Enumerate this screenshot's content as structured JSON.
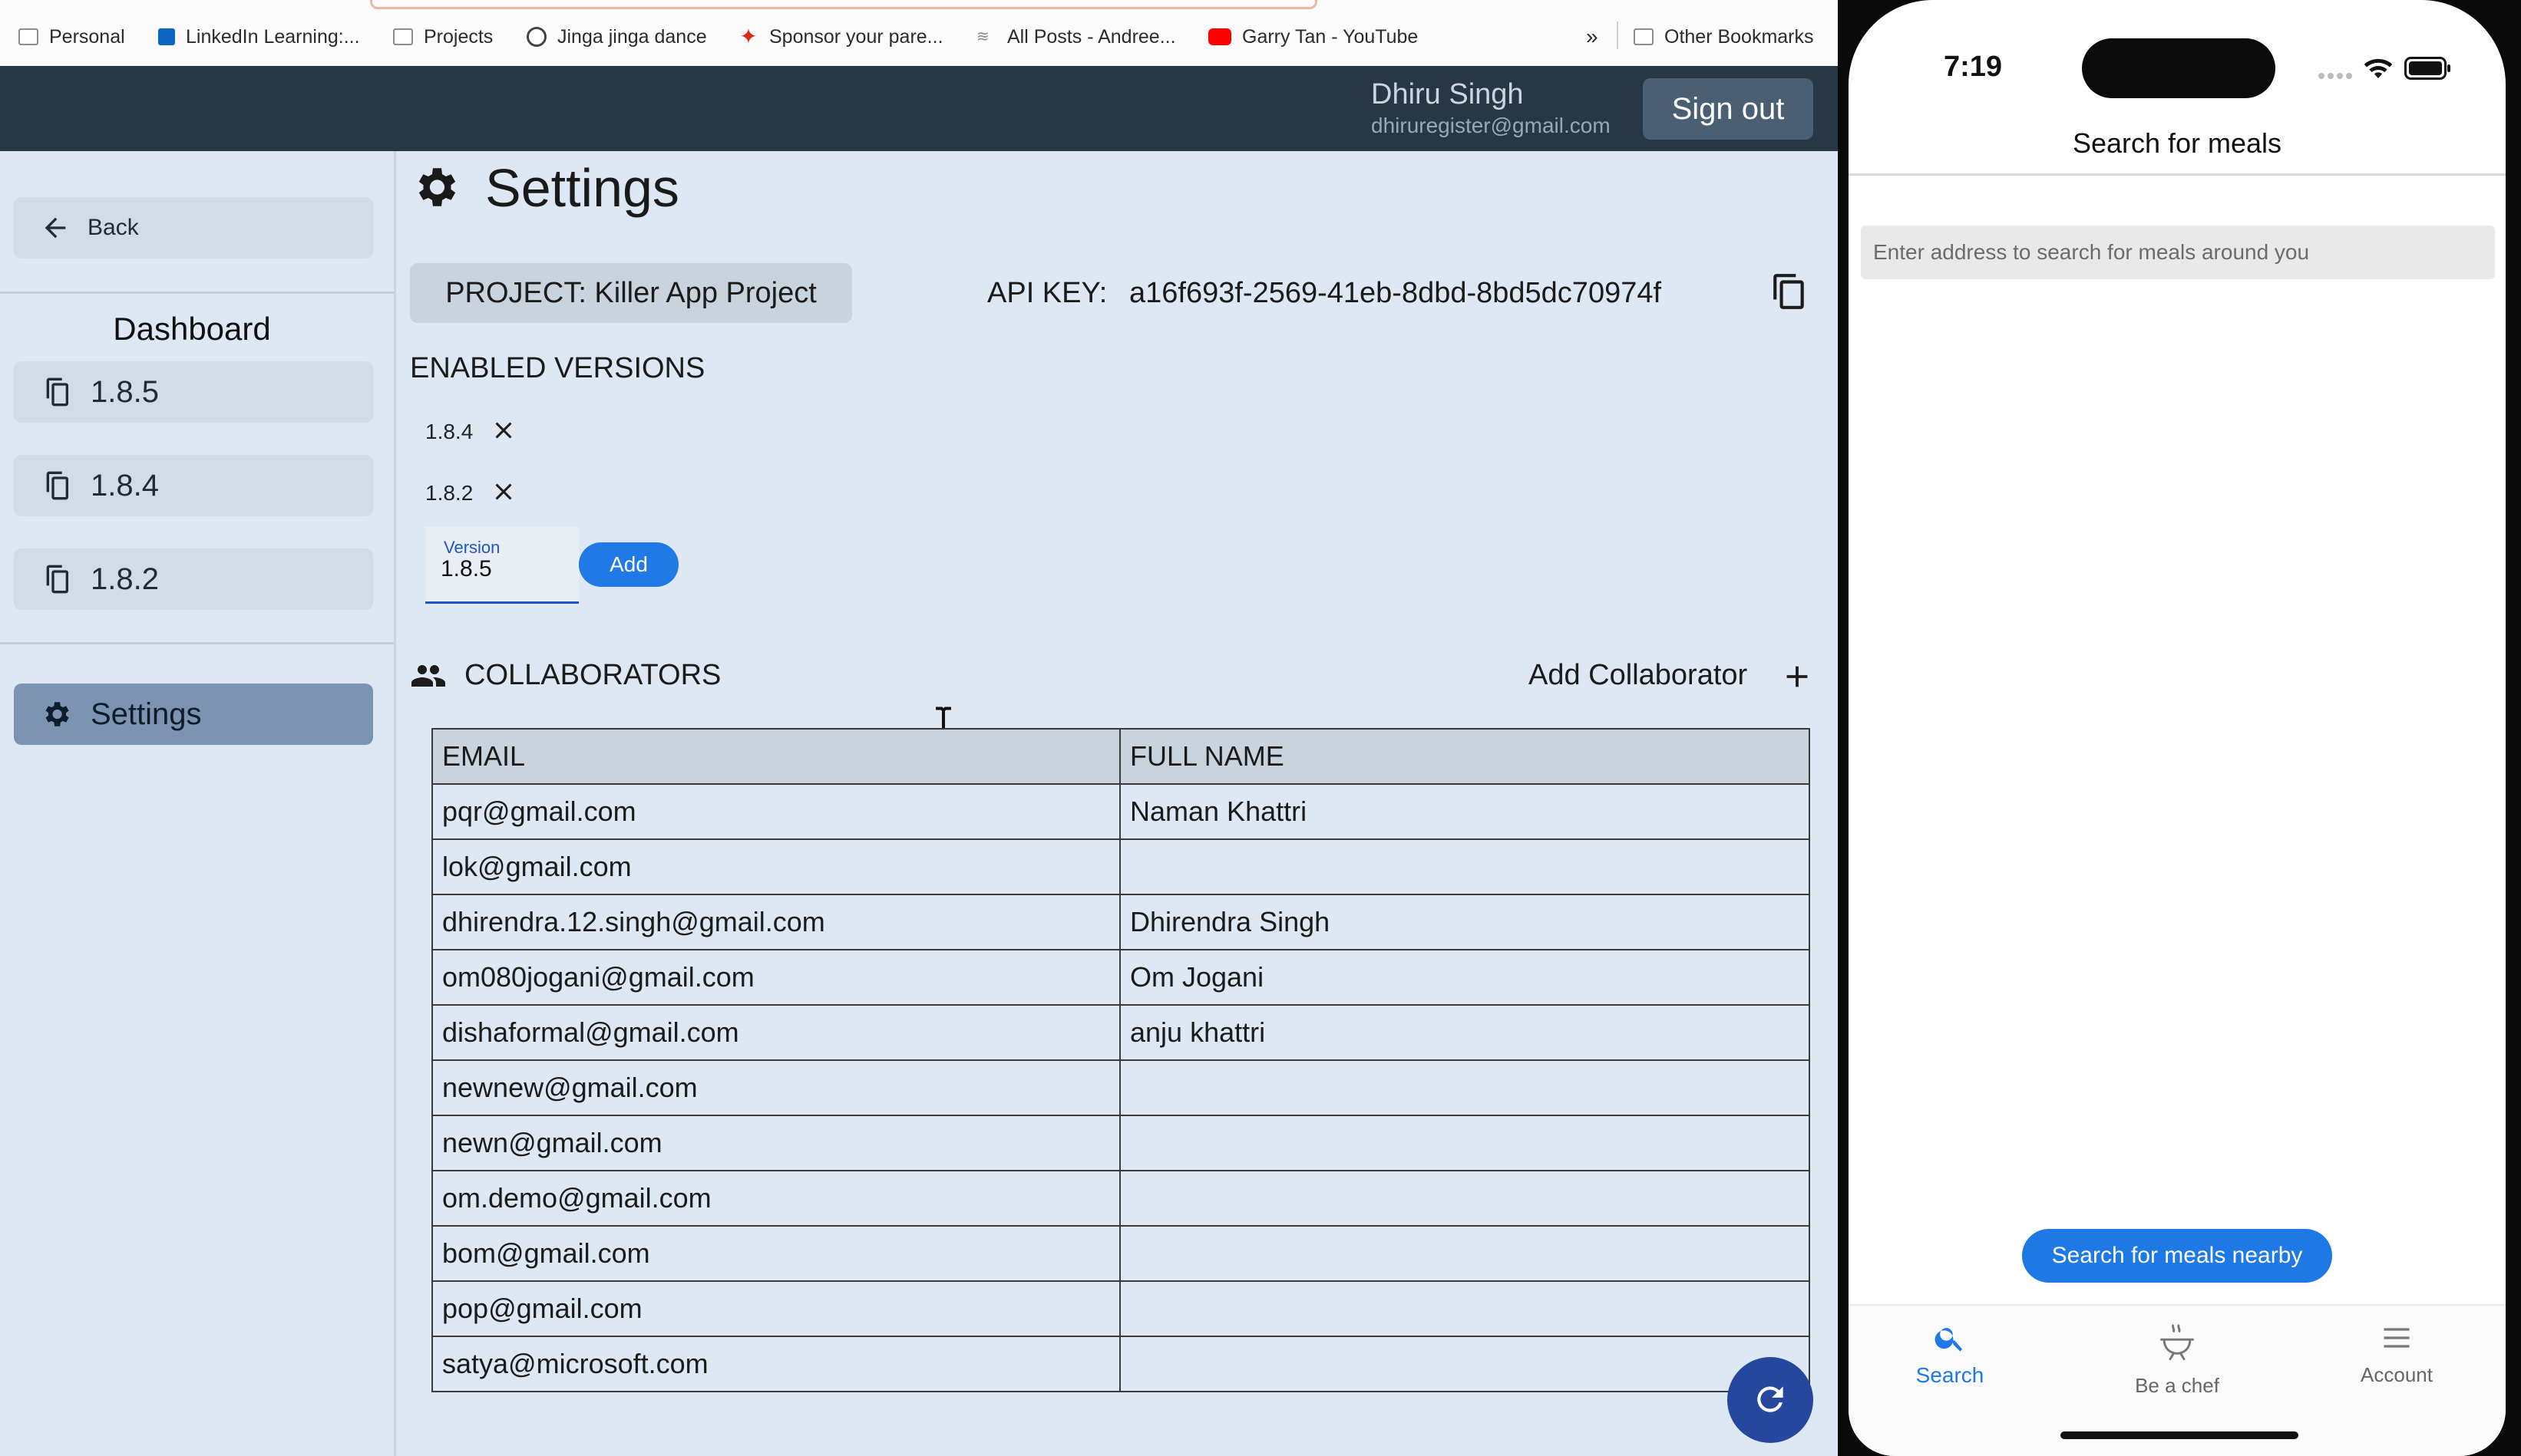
{
  "bookmarks": [
    {
      "label": "Personal",
      "icon": "folder-icon"
    },
    {
      "label": "LinkedIn Learning:...",
      "icon": "linkedin-icon"
    },
    {
      "label": "Projects",
      "icon": "folder-icon"
    },
    {
      "label": "Jinga jinga dance",
      "icon": "globe-icon"
    },
    {
      "label": "Sponsor your pare...",
      "icon": "maple-leaf-icon"
    },
    {
      "label": "All Posts - Andree...",
      "icon": "site-icon"
    },
    {
      "label": "Garry Tan - YouTube",
      "icon": "youtube-icon"
    }
  ],
  "bookmarks_more": "»",
  "other_bookmarks": "Other Bookmarks",
  "header": {
    "user_name": "Dhiru Singh",
    "user_email": "dhiruregister@gmail.com",
    "signout_label": "Sign out"
  },
  "sidebar": {
    "back_label": "Back",
    "dashboard_title": "Dashboard",
    "versions": [
      "1.8.5",
      "1.8.4",
      "1.8.2"
    ],
    "settings_label": "Settings"
  },
  "settings": {
    "title": "Settings",
    "project_label": "PROJECT: Killer App Project",
    "api_key_label": "API KEY:",
    "api_key_value": "a16f693f-2569-41eb-8dbd-8bd5dc70974f",
    "enabled_versions_title": "ENABLED VERSIONS",
    "enabled_versions": [
      "1.8.4",
      "1.8.2"
    ],
    "version_field_label": "Version",
    "version_field_value": "1.8.5",
    "add_label": "Add",
    "collaborators_title": "COLLABORATORS",
    "add_collaborator_label": "Add Collaborator",
    "table_headers": [
      "EMAIL",
      "FULL NAME"
    ],
    "collaborators": [
      {
        "email": "pqr@gmail.com",
        "name": "Naman Khattri"
      },
      {
        "email": "lok@gmail.com",
        "name": ""
      },
      {
        "email": "dhirendra.12.singh@gmail.com",
        "name": "Dhirendra Singh"
      },
      {
        "email": "om080jogani@gmail.com",
        "name": "Om Jogani"
      },
      {
        "email": "dishaformal@gmail.com",
        "name": "anju khattri"
      },
      {
        "email": "newnew@gmail.com",
        "name": ""
      },
      {
        "email": "newn@gmail.com",
        "name": ""
      },
      {
        "email": "om.demo@gmail.com",
        "name": ""
      },
      {
        "email": "bom@gmail.com",
        "name": ""
      },
      {
        "email": "pop@gmail.com",
        "name": ""
      },
      {
        "email": "satya@microsoft.com",
        "name": ""
      }
    ]
  },
  "phone": {
    "time": "7:19",
    "title": "Search for meals",
    "search_placeholder": "Enter address to search for meals around you",
    "search_button": "Search for meals nearby",
    "tabs": [
      {
        "label": "Search",
        "icon": "search-icon",
        "active": true
      },
      {
        "label": "Be a chef",
        "icon": "chef-pot-icon",
        "active": false
      },
      {
        "label": "Account",
        "icon": "menu-icon",
        "active": false
      }
    ]
  },
  "colors": {
    "app_header": "#283746",
    "page_bg": "#dde8f4",
    "accent_blue": "#1f79e6",
    "settings_active": "#7c93b1",
    "fab": "#25479d"
  }
}
